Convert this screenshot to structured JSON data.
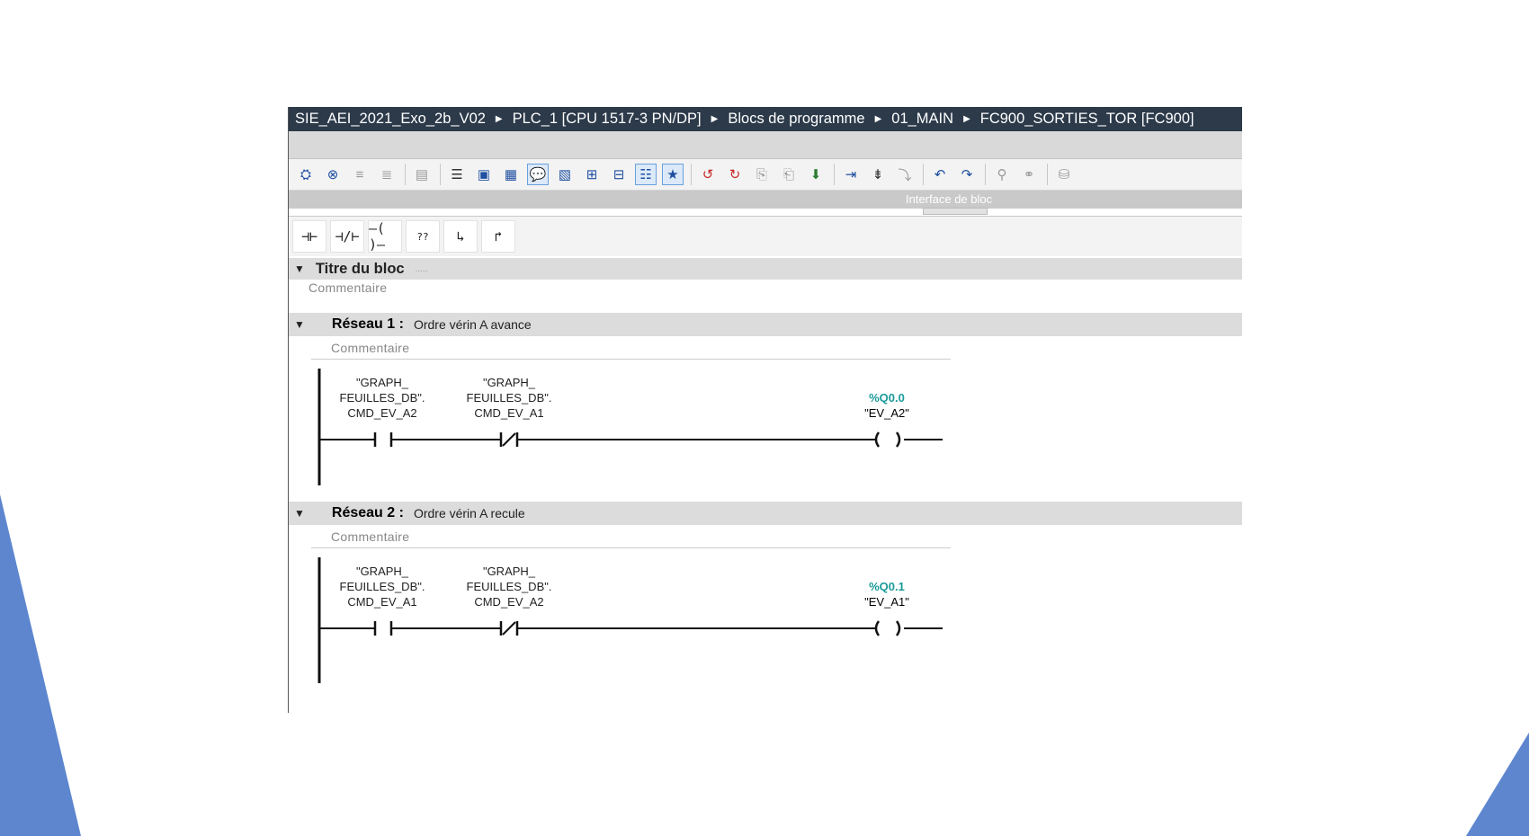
{
  "breadcrumb": {
    "project": "SIE_AEI_2021_Exo_2b_V02",
    "plc": "PLC_1 [CPU 1517-3 PN/DP]",
    "folder": "Blocs de programme",
    "group": "01_MAIN",
    "block": "FC900_SORTIES_TOR [FC900]",
    "separator_icon": "triangle-right-icon"
  },
  "block_interface_label": "Interface de bloc",
  "block": {
    "title": "Titre du bloc",
    "dots": ".....",
    "comment": "Commentaire"
  },
  "networks": [
    {
      "number": "Réseau 1 :",
      "title": "Ordre vérin A avance",
      "comment": "Commentaire",
      "contact1": {
        "line1": "\"GRAPH_",
        "line2": "FEUILLES_DB\".",
        "line3": "CMD_EV_A2",
        "type": "normally-open"
      },
      "contact2": {
        "line1": "\"GRAPH_",
        "line2": "FEUILLES_DB\".",
        "line3": "CMD_EV_A1",
        "type": "normally-closed"
      },
      "coil": {
        "address": "%Q0.0",
        "name": "\"EV_A2\""
      }
    },
    {
      "number": "Réseau 2 :",
      "title": "Ordre vérin A recule",
      "comment": "Commentaire",
      "contact1": {
        "line1": "\"GRAPH_",
        "line2": "FEUILLES_DB\".",
        "line3": "CMD_EV_A1",
        "type": "normally-open"
      },
      "contact2": {
        "line1": "\"GRAPH_",
        "line2": "FEUILLES_DB\".",
        "line3": "CMD_EV_A2",
        "type": "normally-closed"
      },
      "coil": {
        "address": "%Q0.1",
        "name": "\"EV_A1\""
      }
    }
  ],
  "instructions": {
    "no_contact": "⊣⊢",
    "nc_contact": "⊣/⊢",
    "coil": "–( )–",
    "empty_box": "??",
    "open_branch": "↳",
    "close_branch": "↱"
  },
  "colors": {
    "breadcrumb_bg": "#2c3a4a",
    "address_color": "#1a9a9a",
    "slide_accent": "#5d86cf"
  }
}
